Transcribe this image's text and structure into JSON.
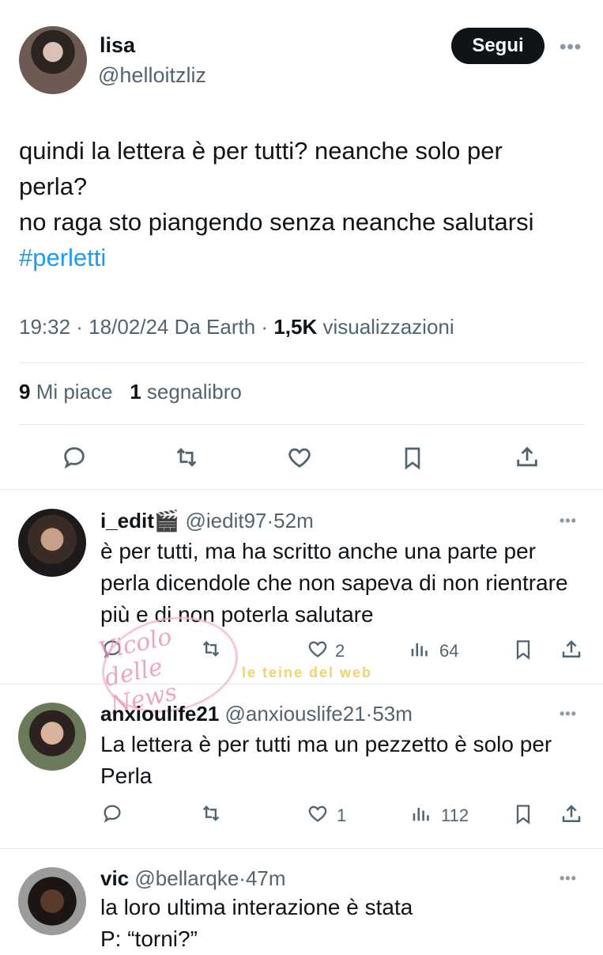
{
  "main_tweet": {
    "author_name": "lisa",
    "handle": "@helloitzliz",
    "follow_label": "Segui",
    "text_lines": [
      "quindi la lettera è per tutti? neanche solo per",
      "perla?",
      "no raga sto piangendo senza neanche salutarsi"
    ],
    "hashtag": "#perletti",
    "time": "19:32 · 18/02/24 Da Earth · ",
    "views_count": "1,5K",
    "views_label": " visualizzazioni",
    "likes_count": "9",
    "likes_label": " Mi piace",
    "bookmarks_count": "1",
    "bookmarks_label": " segnalibro"
  },
  "replies": [
    {
      "name": "i_edit🎬",
      "handle": " @iedit97·52m",
      "text": "è per tutti, ma ha scritto anche una parte per perla dicendole che non sapeva di non rientrare più e di non poterla salutare",
      "likes": "2",
      "views": "64"
    },
    {
      "name": "anxioulife21",
      "handle": " @anxiouslife21·53m",
      "text": "La lettera è per tutti ma un pezzetto è solo per Perla",
      "likes": "1",
      "views": "112"
    },
    {
      "name": "vic",
      "handle": " @bellarqke·47m",
      "text": "la loro ultima interazione è stata P: “torni?”"
    }
  ],
  "watermark": {
    "circle_text": "Vicolo delle News",
    "band_text": "le teine del web"
  },
  "colors": {
    "accent": "#1d9bf0",
    "text": "#0f1419",
    "muted": "#536471",
    "button_bg": "#0f1419"
  },
  "icons": [
    "reply-icon",
    "retweet-icon",
    "heart-icon",
    "bookmark-icon",
    "share-icon",
    "views-icon",
    "more-icon"
  ]
}
